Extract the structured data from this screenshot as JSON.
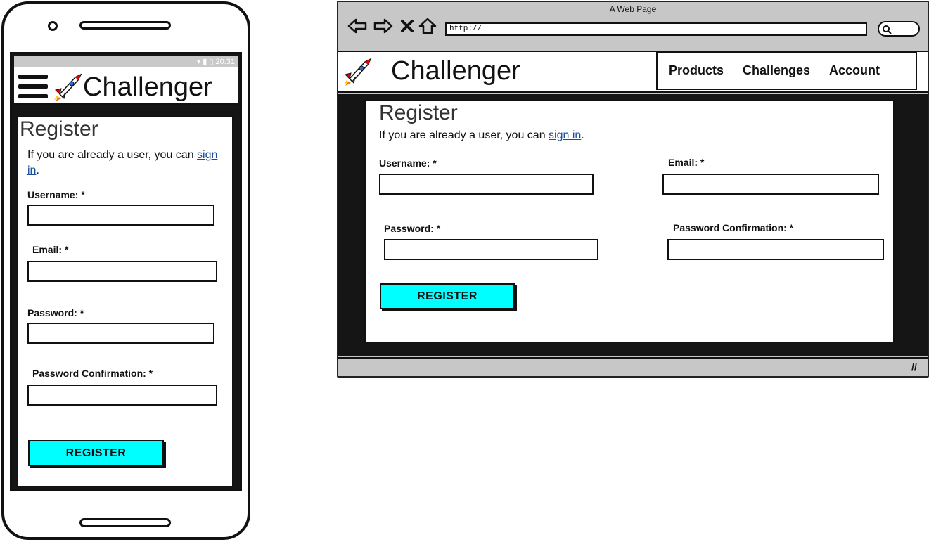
{
  "mobile": {
    "status": {
      "time": "20:31"
    },
    "header": {
      "title": "Challenger"
    },
    "form": {
      "heading": "Register",
      "intro_prefix": "If you are already a user, you can",
      "signin_link": "sign in",
      "period": ".",
      "username_label": "Username: *",
      "email_label": "Email: *",
      "password_label": "Password: *",
      "confirm_label": "Password Confirmation: *",
      "register_button": "REGISTER"
    }
  },
  "browser": {
    "window_title": "A Web Page",
    "url": "http://",
    "header": {
      "title": "Challenger"
    },
    "menu": [
      "Products",
      "Challenges",
      "Account"
    ],
    "form": {
      "heading": "Register",
      "intro_prefix": "If you are already a user, you can",
      "signin_link": "sign in",
      "period": ".",
      "username_label": "Username: *",
      "email_label": "Email: *",
      "password_label": "Password: *",
      "confirm_label": "Password Confirmation: *",
      "register_button": "REGISTER"
    }
  },
  "colors": {
    "button": "#00ffff",
    "link": "#1a4f9c",
    "backdrop": "#151515",
    "chrome": "#c7c7c7"
  }
}
